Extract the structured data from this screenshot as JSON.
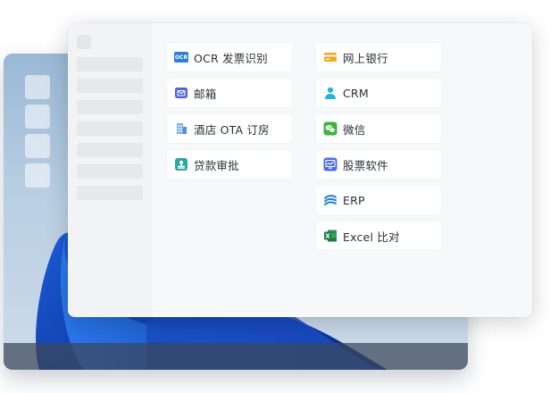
{
  "desktop": {
    "icon_count": 4
  },
  "sidebar": {
    "placeholder_rows": 7
  },
  "apps": {
    "left_column": [
      {
        "label": "OCR 发票识别",
        "icon": "ocr-icon",
        "badge_text": "OCR",
        "color": "#2b7de1"
      },
      {
        "label": "邮箱",
        "icon": "mail-icon",
        "color": "#4a63e0"
      },
      {
        "label": "酒店 OTA 订房",
        "icon": "hotel-icon",
        "color": "#5b9bd5"
      },
      {
        "label": "贷款审批",
        "icon": "approval-stamp-icon",
        "color": "#2aa6a6"
      }
    ],
    "right_column": [
      {
        "label": "网上银行",
        "icon": "bank-card-icon",
        "color": "#f5a623"
      },
      {
        "label": "CRM",
        "icon": "user-icon",
        "color": "#21b6d9"
      },
      {
        "label": "微信",
        "icon": "wechat-icon",
        "color": "#3fb33f"
      },
      {
        "label": "股票软件",
        "icon": "stock-chart-icon",
        "color": "#4a6cf0"
      },
      {
        "label": "ERP",
        "icon": "erp-icon",
        "color": "#1f7fd6"
      },
      {
        "label": "Excel 比对",
        "icon": "excel-icon",
        "color": "#1e7b45"
      }
    ]
  }
}
